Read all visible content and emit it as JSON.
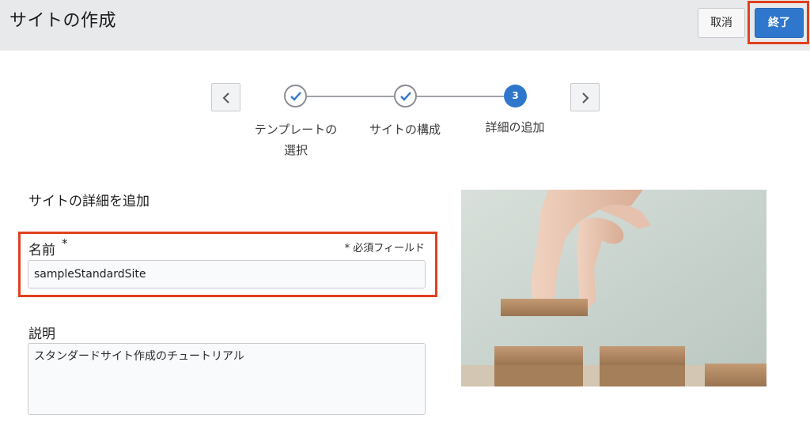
{
  "header": {
    "title": "サイトの作成",
    "cancel_label": "取消",
    "finish_label": "終了"
  },
  "wizard": {
    "steps": [
      {
        "label": "テンプレートの\n選択",
        "status": "completed"
      },
      {
        "label": "サイトの構成",
        "status": "completed"
      },
      {
        "label": "詳細の追加",
        "status": "current",
        "number": "3"
      }
    ]
  },
  "form": {
    "section_title": "サイトの詳細を追加",
    "name_label": "名前",
    "required_marker": "*",
    "required_note": "* 必須フィールド",
    "name_value": "sampleStandardSite",
    "description_label": "説明",
    "description_value": "スタンダードサイト作成のチュートリアル"
  },
  "colors": {
    "accent": "#2f77cc",
    "highlight": "#e0401f",
    "header_bg": "#e8e9eb"
  },
  "icons": {
    "prev": "chevron-left-icon",
    "next": "chevron-right-icon",
    "check": "check-icon"
  }
}
